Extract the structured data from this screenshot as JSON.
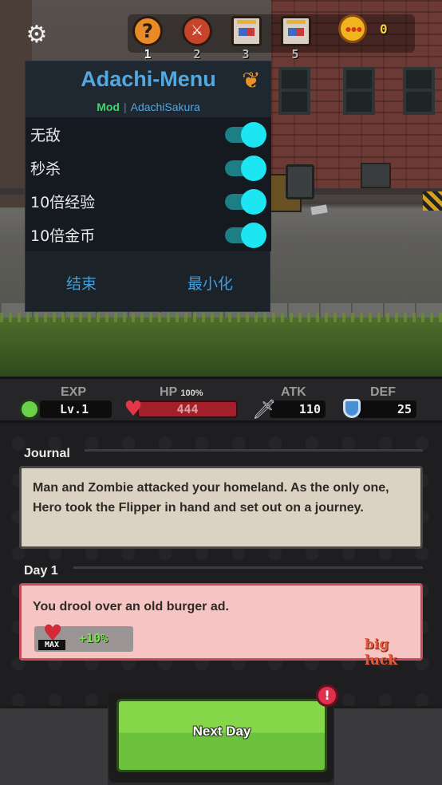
{
  "hud": {
    "slots": [
      {
        "icon": "question-icon",
        "number": "1"
      },
      {
        "icon": "sword-badge-icon",
        "number": "2"
      },
      {
        "icon": "treasure-box-icon",
        "number": "3"
      },
      {
        "icon": "treasure-box-icon",
        "number": "5"
      }
    ],
    "gold": "0",
    "settings_icon": "gear-icon",
    "coin_icon": "coin-icon"
  },
  "mod_menu": {
    "title": "Adachi-Menu",
    "tag": "Mod",
    "separator": "|",
    "author": "AdachiSakura",
    "icon": "maple-leaf-icon",
    "items": [
      {
        "label": "无敌",
        "enabled": true
      },
      {
        "label": "秒杀",
        "enabled": true
      },
      {
        "label": "10倍经验",
        "enabled": true
      },
      {
        "label": "10倍金币",
        "enabled": true
      }
    ],
    "end_button": "结束",
    "minimize_button": "最小化",
    "colors": {
      "accent": "#52a8df",
      "tag": "#3ed66a",
      "toggle_on": "#1de6f2"
    }
  },
  "stats": {
    "exp": {
      "label": "EXP",
      "value": "Lv.1"
    },
    "hp": {
      "label": "HP",
      "percent_label": "100%",
      "value": "444",
      "fill": 1.0
    },
    "atk": {
      "label": "ATK",
      "value": "110"
    },
    "def": {
      "label": "DEF",
      "value": "25"
    }
  },
  "journal": {
    "heading": "Journal",
    "text": "Man and Zombie attacked your homeland. As the only one, Hero took the Flipper in hand and set out on a journey."
  },
  "day": {
    "heading": "Day 1",
    "event": "You drool over an old burger ad.",
    "bonus_badge": "MAX",
    "bonus_value": "+10%",
    "luck_tag": "big luck"
  },
  "next_button": "Next Day",
  "alert_badge": "!"
}
